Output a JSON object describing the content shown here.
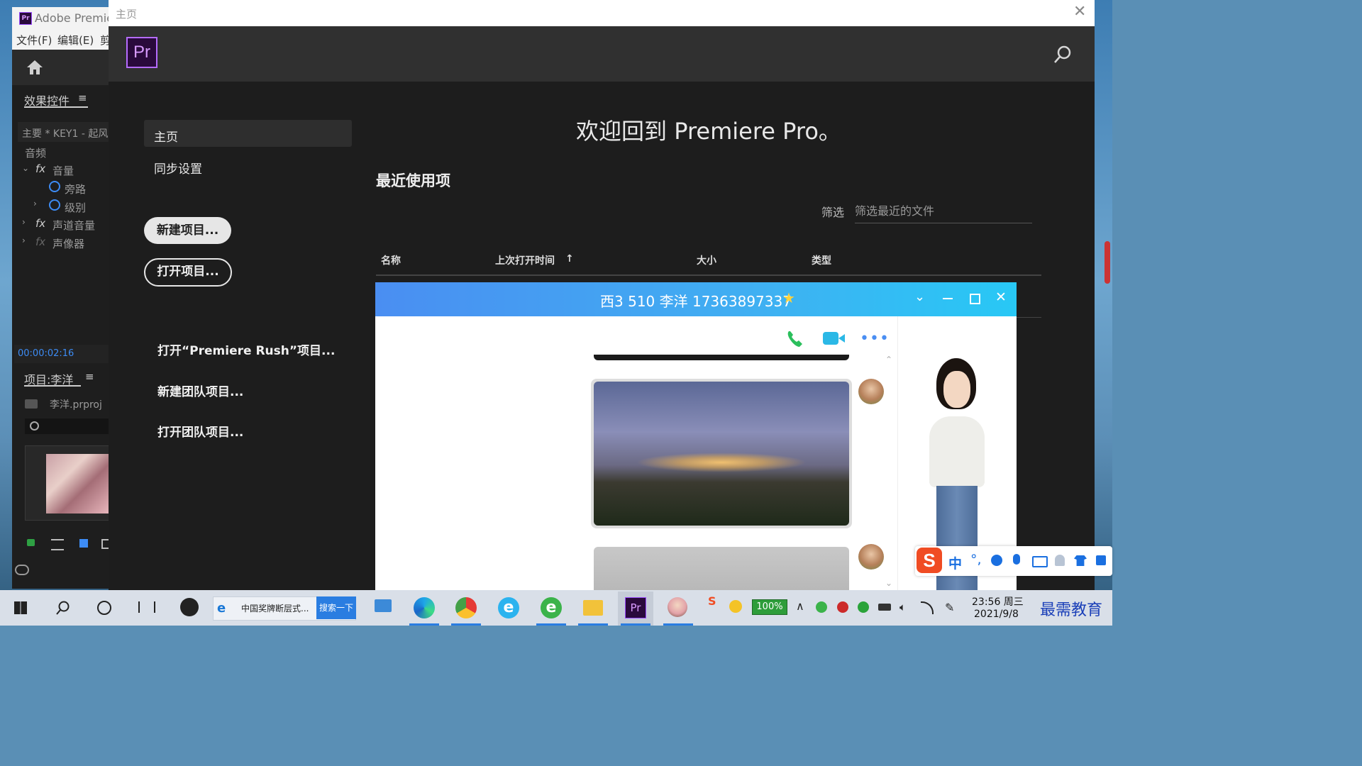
{
  "premiere_main": {
    "title": "Adobe Premie",
    "menu": [
      "文件(F)",
      "编辑(E)",
      "剪"
    ],
    "effects_panel": {
      "tab": "效果控件",
      "clip": "主要 * KEY1 - 起风",
      "section": "音频",
      "items": [
        {
          "label": "音量"
        },
        {
          "label": "旁路"
        },
        {
          "label": "级别"
        },
        {
          "label": "声道音量"
        },
        {
          "label": "声像器"
        }
      ],
      "timecode": "00:00:02:16"
    },
    "project_panel": {
      "tab": "项目:李洋",
      "file": "李洋.prproj"
    }
  },
  "home_dialog": {
    "window_title": "主页",
    "logo": "Pr",
    "nav": [
      {
        "label": "主页"
      },
      {
        "label": "同步设置"
      }
    ],
    "new_project_label": "新建项目...",
    "open_project_label": "打开项目...",
    "links": [
      {
        "label": "打开“Premiere Rush”项目..."
      },
      {
        "label": "新建团队项目..."
      },
      {
        "label": "打开团队项目..."
      }
    ],
    "welcome": "欢迎回到 Premiere Pro。",
    "recent_title": "最近使用项",
    "filter_label": "筛选",
    "filter_placeholder": "筛选最近的文件",
    "columns": [
      "名称",
      "上次打开时间",
      "大小",
      "类型"
    ]
  },
  "chat_window": {
    "title": "西3 510 李洋 17363897337"
  },
  "taskbar": {
    "ie_tab_label": "中国奖牌断层式...",
    "search_button": "搜索一下",
    "battery": "100%",
    "time": "23:56 周三",
    "date": "2021/9/8",
    "watermark": "最需教育"
  },
  "ime": {
    "mode": "中"
  },
  "colors": {
    "premiere_purple": "#2a0a3c",
    "premiere_logo_text": "#d89bff",
    "chat_title_start": "#4a8ef2",
    "chat_title_end": "#28c8f5"
  }
}
